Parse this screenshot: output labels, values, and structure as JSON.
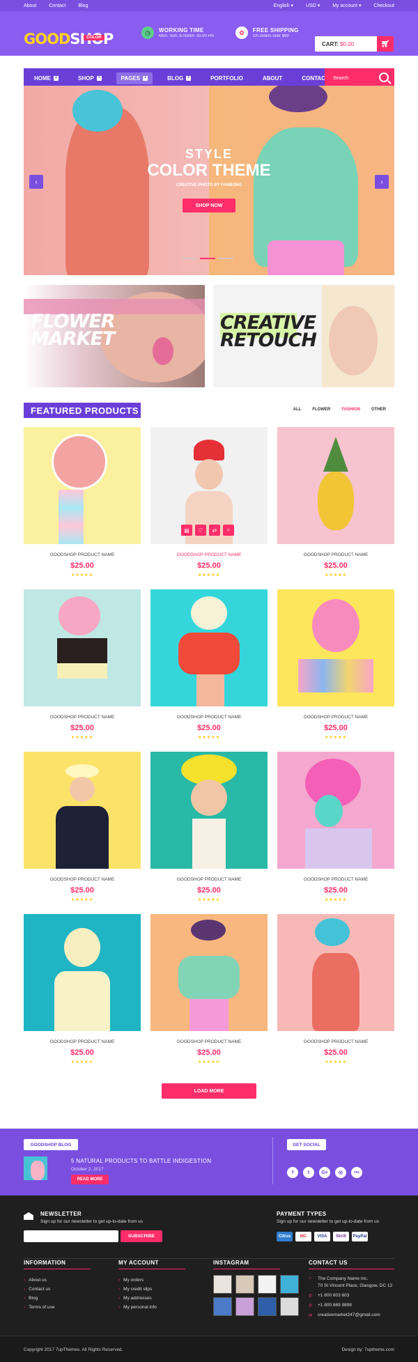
{
  "topbar": {
    "links": [
      "About",
      "Contact",
      "Blog"
    ],
    "right": [
      "English",
      "USD",
      "My account",
      "Checkout"
    ]
  },
  "header": {
    "logo_good": "GOOD",
    "logo_shop": "SHOP",
    "logo_badge": "COLOR",
    "working_title": "WORKING TIME",
    "working_sub": "Mon- Sun: 8.00AM- 20.00 Pm",
    "shipping_title": "FREE SHIPPING",
    "shipping_sub": "On orders over $99",
    "cart_label": "CART:",
    "cart_value": "$0.00"
  },
  "nav": {
    "items": [
      "HOME",
      "SHOP",
      "PAGES",
      "BLOG",
      "PORTFOLIO",
      "ABOUT",
      "CONTACT"
    ],
    "search_placeholder": "Search"
  },
  "hero": {
    "line1": "STYLE",
    "line2": "COLOR THEME",
    "line3": "CREATIVE PHOTO BY FANBONG",
    "button": "SHOP NOW",
    "active_slide": 2,
    "slides": 3
  },
  "banners": [
    {
      "line1": "FLOWER",
      "line2": "MARKET"
    },
    {
      "line1": "CREATIVE",
      "line2": "RETOUCH"
    }
  ],
  "featured": {
    "title": "FEATURED PRODUCTS",
    "filters": [
      "ALL",
      "FLOWER",
      "FASHION",
      "OTHER"
    ],
    "active_filter": "FASHION",
    "stars": "★★★★★",
    "products": [
      {
        "name": "GOODSHOP PRODUCT NAME",
        "price": "$25.00"
      },
      {
        "name": "GOODSHOP PRODUCT NAME",
        "price": "$25.00"
      },
      {
        "name": "GOODSHOP PRODUCT NAME",
        "price": "$25.00"
      },
      {
        "name": "GOODSHOP PRODUCT NAME",
        "price": "$25.00"
      },
      {
        "name": "GOODSHOP PRODUCT NAME",
        "price": "$25.00"
      },
      {
        "name": "GOODSHOP PRODUCT NAME",
        "price": "$25.00"
      },
      {
        "name": "GOODSHOP PRODUCT NAME",
        "price": "$25.00"
      },
      {
        "name": "GOODSHOP PRODUCT NAME",
        "price": "$25.00"
      },
      {
        "name": "GOODSHOP PRODUCT NAME",
        "price": "$25.00"
      },
      {
        "name": "GOODSHOP PRODUCT NAME",
        "price": "$25.00"
      },
      {
        "name": "GOODSHOP PRODUCT NAME",
        "price": "$25.00"
      },
      {
        "name": "GOODSHOP PRODUCT NAME",
        "price": "$25.00"
      }
    ],
    "load_more": "LOAD MORE"
  },
  "blog": {
    "label": "GOODSHOP BLOG",
    "post_title": "5 NATURAL PRODUCTS TO BATTLE INDIGESTION",
    "post_date": "October 2, 2017",
    "read_more": "READ MORE",
    "social_label": "GET SOCIAL",
    "social": [
      "f",
      "t",
      "G+",
      "◎",
      "rss"
    ]
  },
  "footer": {
    "newsletter_title": "NEWSLETTER",
    "newsletter_sub": "Sign up for our newsletter to get up-to-date from us",
    "subscribe": "SUBSCRIBE",
    "payment_title": "PAYMENT TYPES",
    "payment_sub": "Sign up for our newsletter to get up-to-date from us",
    "payments": [
      "Citrus",
      "MC",
      "VISA",
      "Skrill",
      "PayPal"
    ],
    "information_title": "INFORMATION",
    "information": [
      "About us",
      "Contact us",
      "Blog",
      "Terms of use"
    ],
    "account_title": "MY ACCOUNT",
    "account": [
      "My orders",
      "My credit slips",
      "My addresses",
      "My personal info"
    ],
    "instagram_title": "INSTAGRAM",
    "contact_title": "CONTACT US",
    "contact": [
      "The Company Name Inc.",
      "70 St Vincent Place, Glasgow, DC 12",
      "+1 800 603 603",
      "+1 800 889 9898",
      "creativemarket247@gmail.com"
    ],
    "copyright": "Copyright 2017 7upThemes. All Rights Reserved.",
    "design_by": "Design by: 7uptheme.com"
  },
  "colors": {
    "purple": "#8a5cf0",
    "pink": "#ff2d6a",
    "yellow": "#ffd21f"
  }
}
